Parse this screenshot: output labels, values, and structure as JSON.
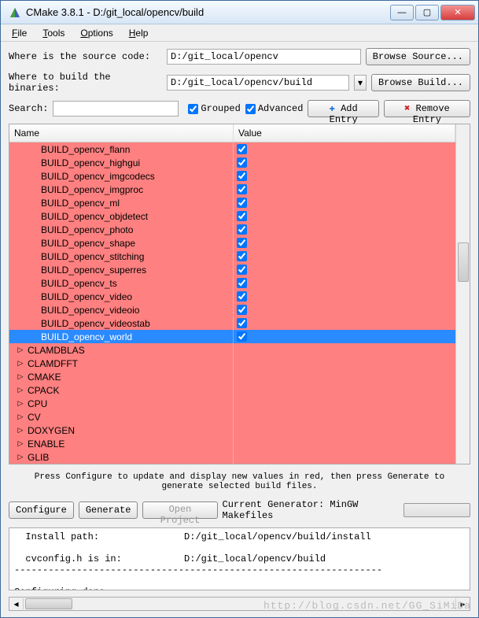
{
  "window": {
    "title": "CMake 3.8.1 - D:/git_local/opencv/build",
    "min": "—",
    "max": "▢",
    "close": "✕"
  },
  "menu": {
    "file": "File",
    "tools": "Tools",
    "options": "Options",
    "help": "Help"
  },
  "fields": {
    "src_label": "Where is the source code:",
    "src_value": "D:/git_local/opencv",
    "src_browse": "Browse Source...",
    "bin_label": "Where to build the binaries:",
    "bin_value": "D:/git_local/opencv/build",
    "bin_browse": "Browse Build...",
    "search_label": "Search:",
    "search_value": "",
    "grouped": "Grouped",
    "advanced": "Advanced",
    "add_entry": "Add Entry",
    "remove_entry": "Remove Entry"
  },
  "table": {
    "col_name": "Name",
    "col_value": "Value",
    "rows": [
      {
        "name": "BUILD_opencv_flann",
        "checked": true
      },
      {
        "name": "BUILD_opencv_highgui",
        "checked": true
      },
      {
        "name": "BUILD_opencv_imgcodecs",
        "checked": true
      },
      {
        "name": "BUILD_opencv_imgproc",
        "checked": true
      },
      {
        "name": "BUILD_opencv_ml",
        "checked": true
      },
      {
        "name": "BUILD_opencv_objdetect",
        "checked": true
      },
      {
        "name": "BUILD_opencv_photo",
        "checked": true
      },
      {
        "name": "BUILD_opencv_shape",
        "checked": true
      },
      {
        "name": "BUILD_opencv_stitching",
        "checked": true
      },
      {
        "name": "BUILD_opencv_superres",
        "checked": true
      },
      {
        "name": "BUILD_opencv_ts",
        "checked": true
      },
      {
        "name": "BUILD_opencv_video",
        "checked": true
      },
      {
        "name": "BUILD_opencv_videoio",
        "checked": true
      },
      {
        "name": "BUILD_opencv_videostab",
        "checked": true
      },
      {
        "name": "BUILD_opencv_world",
        "checked": true,
        "selected": true
      }
    ],
    "groups": [
      "CLAMDBLAS",
      "CLAMDFFT",
      "CMAKE",
      "CPACK",
      "CPU",
      "CV",
      "DOXYGEN",
      "ENABLE",
      "GLIB"
    ]
  },
  "hint": "Press Configure to update and display new values in red, then press Generate to generate selected build files.",
  "buttons": {
    "configure": "Configure",
    "generate": "Generate",
    "open_project": "Open Project",
    "gen_label": "Current Generator: MinGW Makefiles"
  },
  "output": "  Install path:               D:/git_local/opencv/build/install\n\n  cvconfig.h is in:           D:/git_local/opencv/build\n-----------------------------------------------------------------\n\nConfiguring done",
  "watermark": "http://blog.csdn.net/GG_SiMiDa"
}
